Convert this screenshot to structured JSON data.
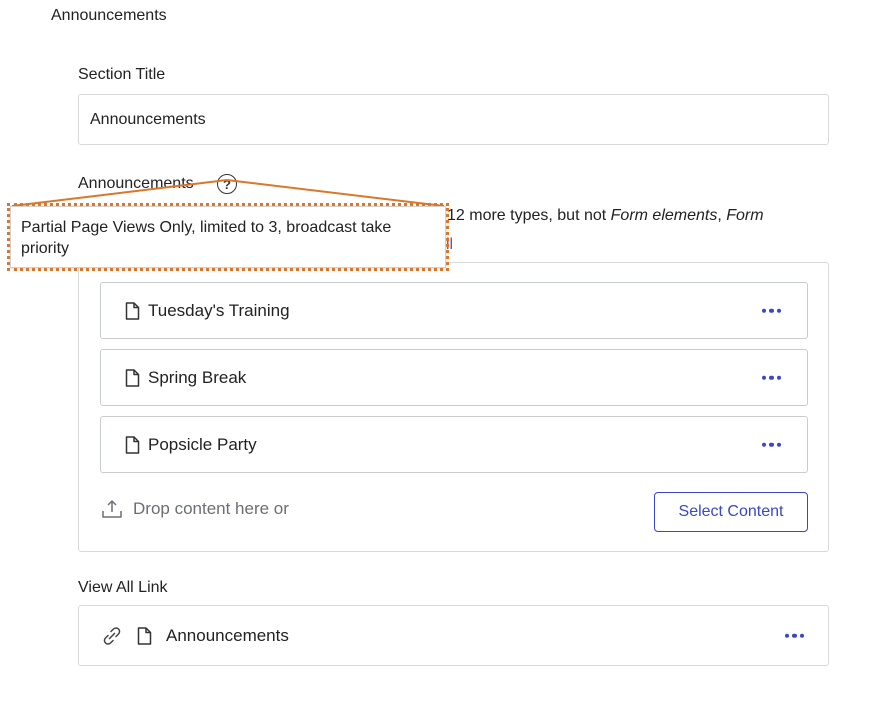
{
  "header": {
    "title": "Announcements"
  },
  "section_title": {
    "label": "Section Title",
    "value": "Announcements"
  },
  "announcements": {
    "label": "Announcements",
    "help_icon": "question-circle-icon",
    "types_prefix": "12 more types, but not ",
    "types_em1": "Form elements",
    "types_sep": ", ",
    "types_em2": "Form",
    "view_all_fragment": "ll",
    "items": [
      {
        "title": "Tuesday's Training",
        "icon": "document-icon"
      },
      {
        "title": "Spring Break",
        "icon": "document-icon"
      },
      {
        "title": "Popsicle Party",
        "icon": "document-icon"
      }
    ],
    "drop_text": "Drop content here or",
    "select_button": "Select Content"
  },
  "tooltip": {
    "text": "Partial Page Views Only, limited to 3, broadcast take priority"
  },
  "view_all_link": {
    "label": "View All Link",
    "title": "Announcements"
  },
  "colors": {
    "accent": "#3b46c9",
    "callout": "#d9772a",
    "border": "#d7dadd"
  }
}
